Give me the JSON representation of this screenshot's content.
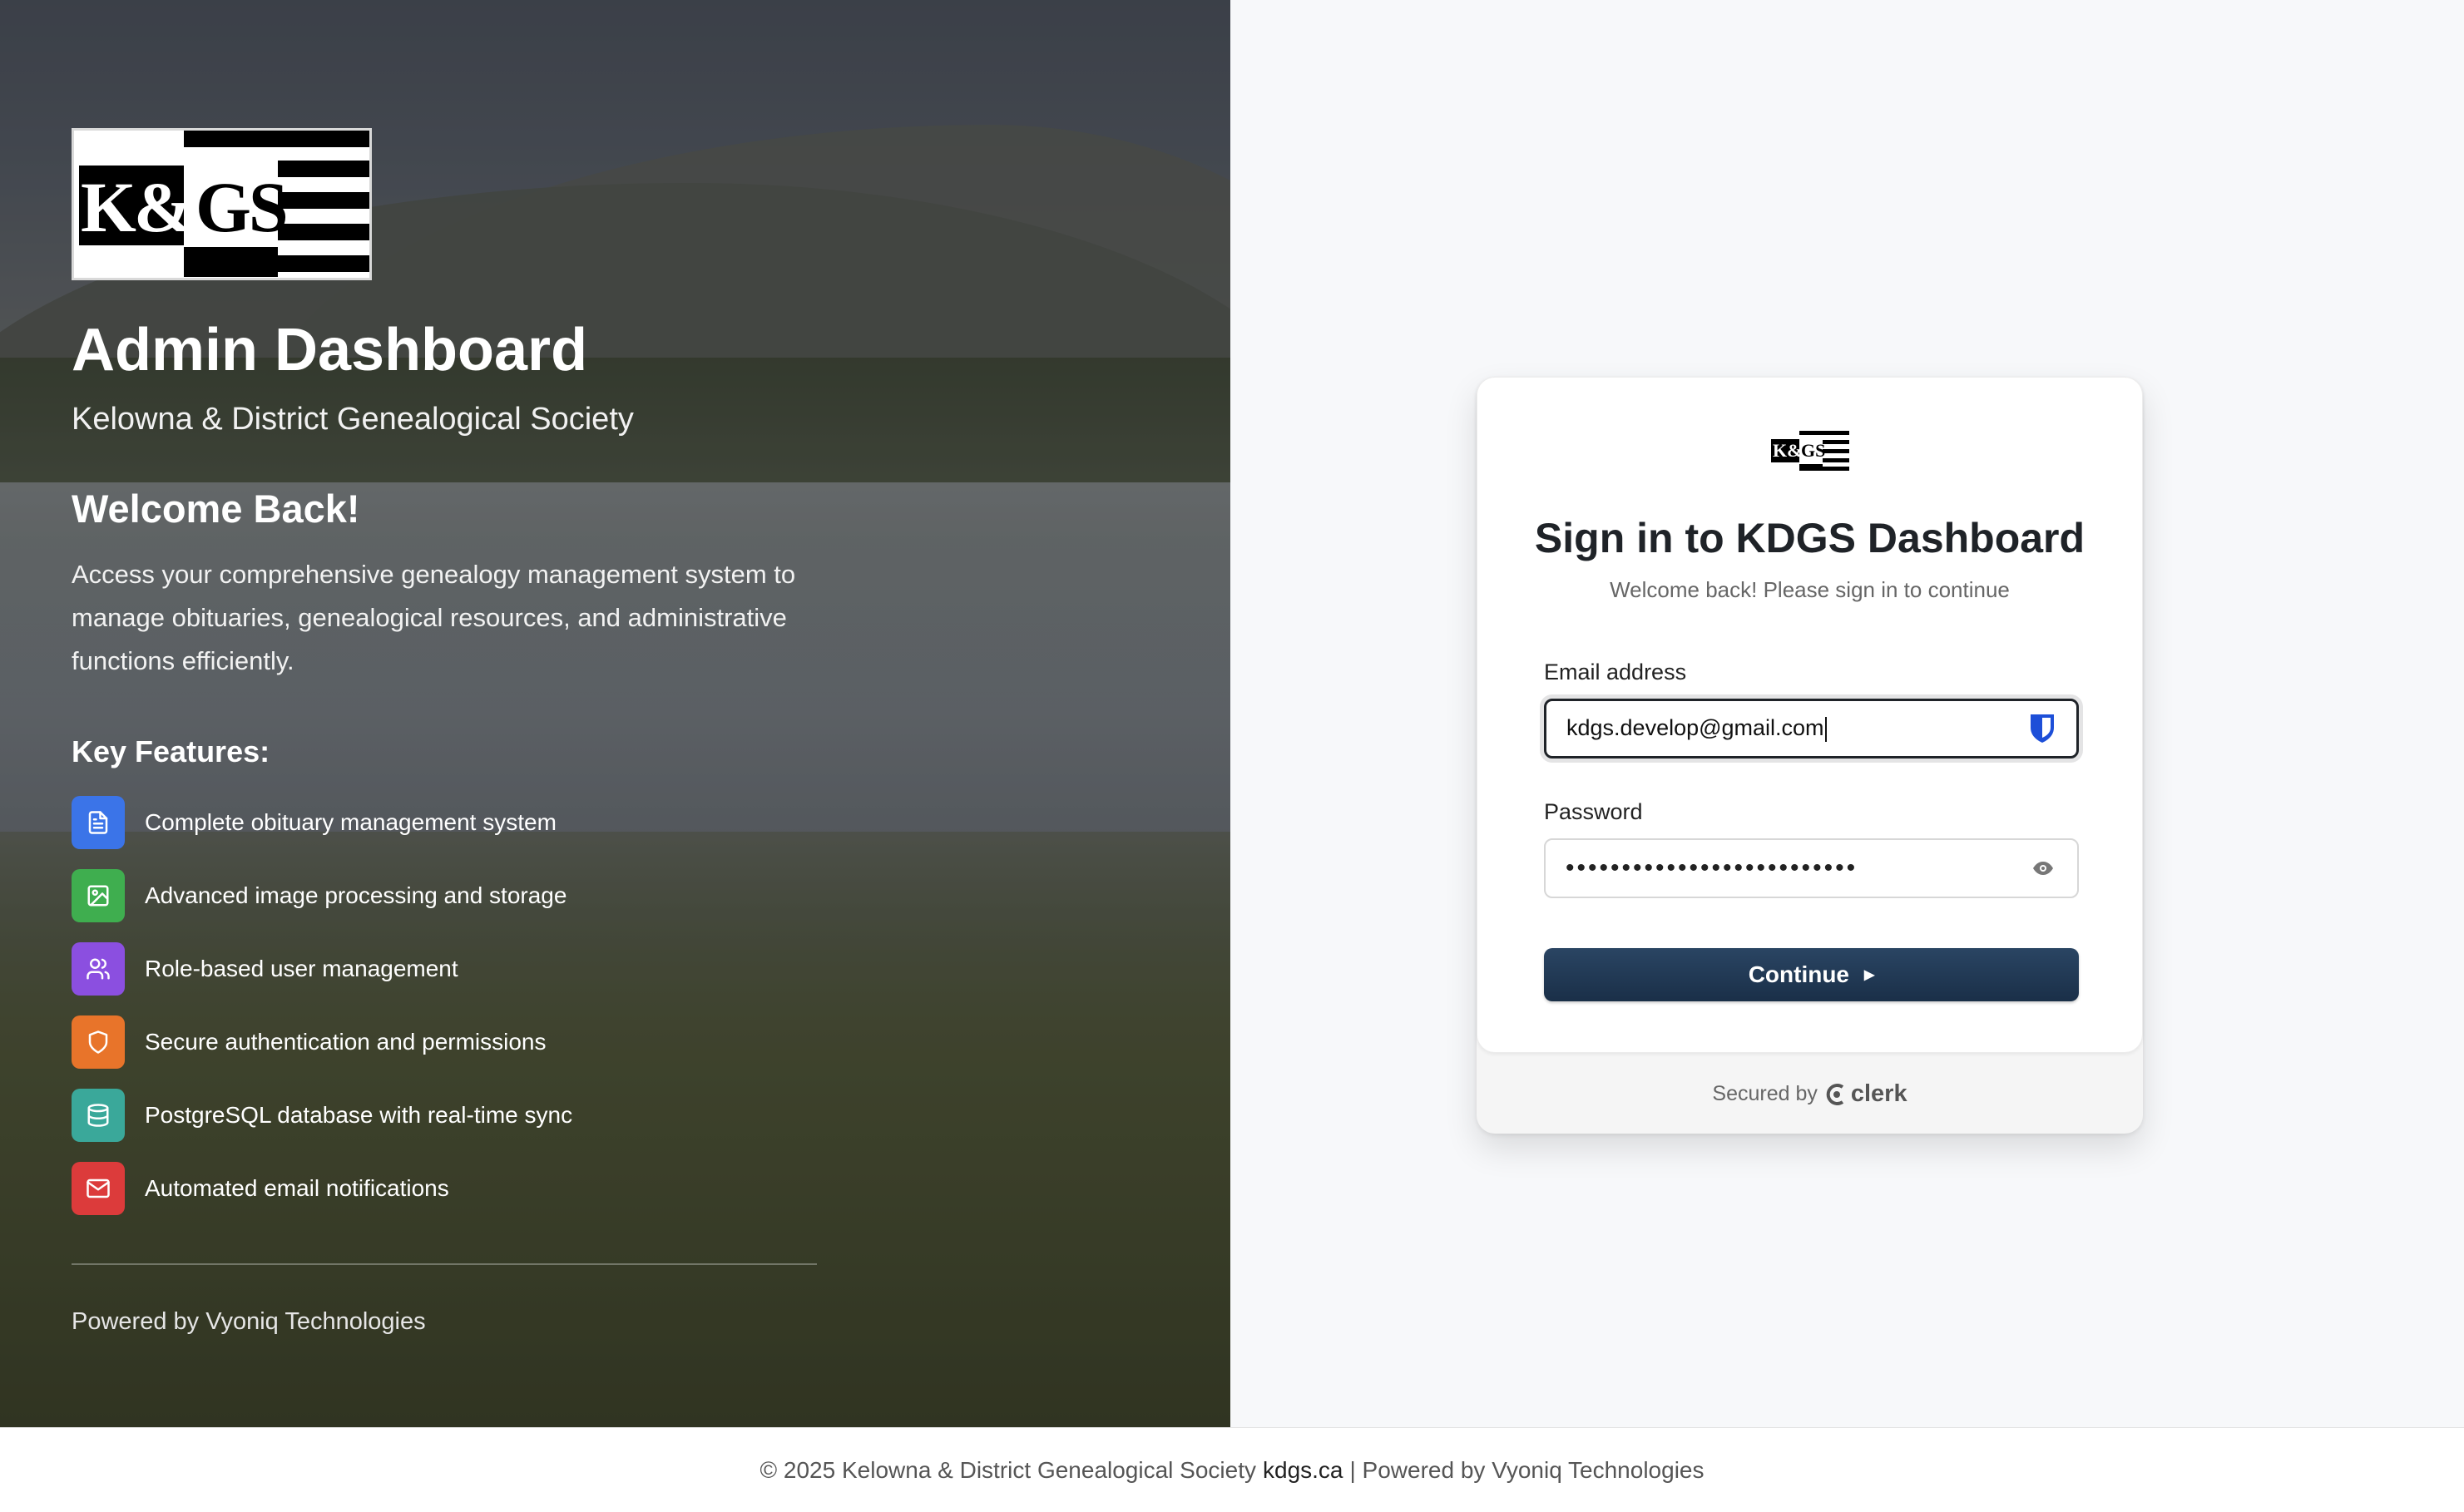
{
  "hero": {
    "logo_text": "K&DGS",
    "title": "Admin Dashboard",
    "subtitle": "Kelowna & District Genealogical Society",
    "welcome": "Welcome Back!",
    "description": "Access your comprehensive genealogy management system to manage obituaries, genealogical resources, and administrative functions efficiently.",
    "features_heading": "Key Features:",
    "features": [
      {
        "label": "Complete obituary management system",
        "icon": "document-icon",
        "color": "#3b74e8"
      },
      {
        "label": "Advanced image processing and storage",
        "icon": "image-icon",
        "color": "#3fae4f"
      },
      {
        "label": "Role-based user management",
        "icon": "users-icon",
        "color": "#8b4fe0"
      },
      {
        "label": "Secure authentication and permissions",
        "icon": "shield-icon",
        "color": "#e8742a"
      },
      {
        "label": "PostgreSQL database with real-time sync",
        "icon": "database-icon",
        "color": "#3aa89a"
      },
      {
        "label": "Automated email notifications",
        "icon": "mail-icon",
        "color": "#dc3b3b"
      }
    ],
    "powered_by": "Powered by Vyoniq Technologies"
  },
  "signin": {
    "title": "Sign in to KDGS Dashboard",
    "subtitle": "Welcome back! Please sign in to continue",
    "email_label": "Email address",
    "email_value": "kdgs.develop@gmail.com",
    "password_label": "Password",
    "password_mask": "••••••••••••••••••••••••••",
    "continue_label": "Continue",
    "secured_by": "Secured by",
    "secured_brand": "clerk"
  },
  "footer": {
    "copyright": "© 2025 Kelowna & District Genealogical Society",
    "link": "kdgs.ca",
    "powered": "| Powered by Vyoniq Technologies"
  },
  "colors": {
    "button": "#1e3550",
    "accent_dark": "#1f2328"
  }
}
